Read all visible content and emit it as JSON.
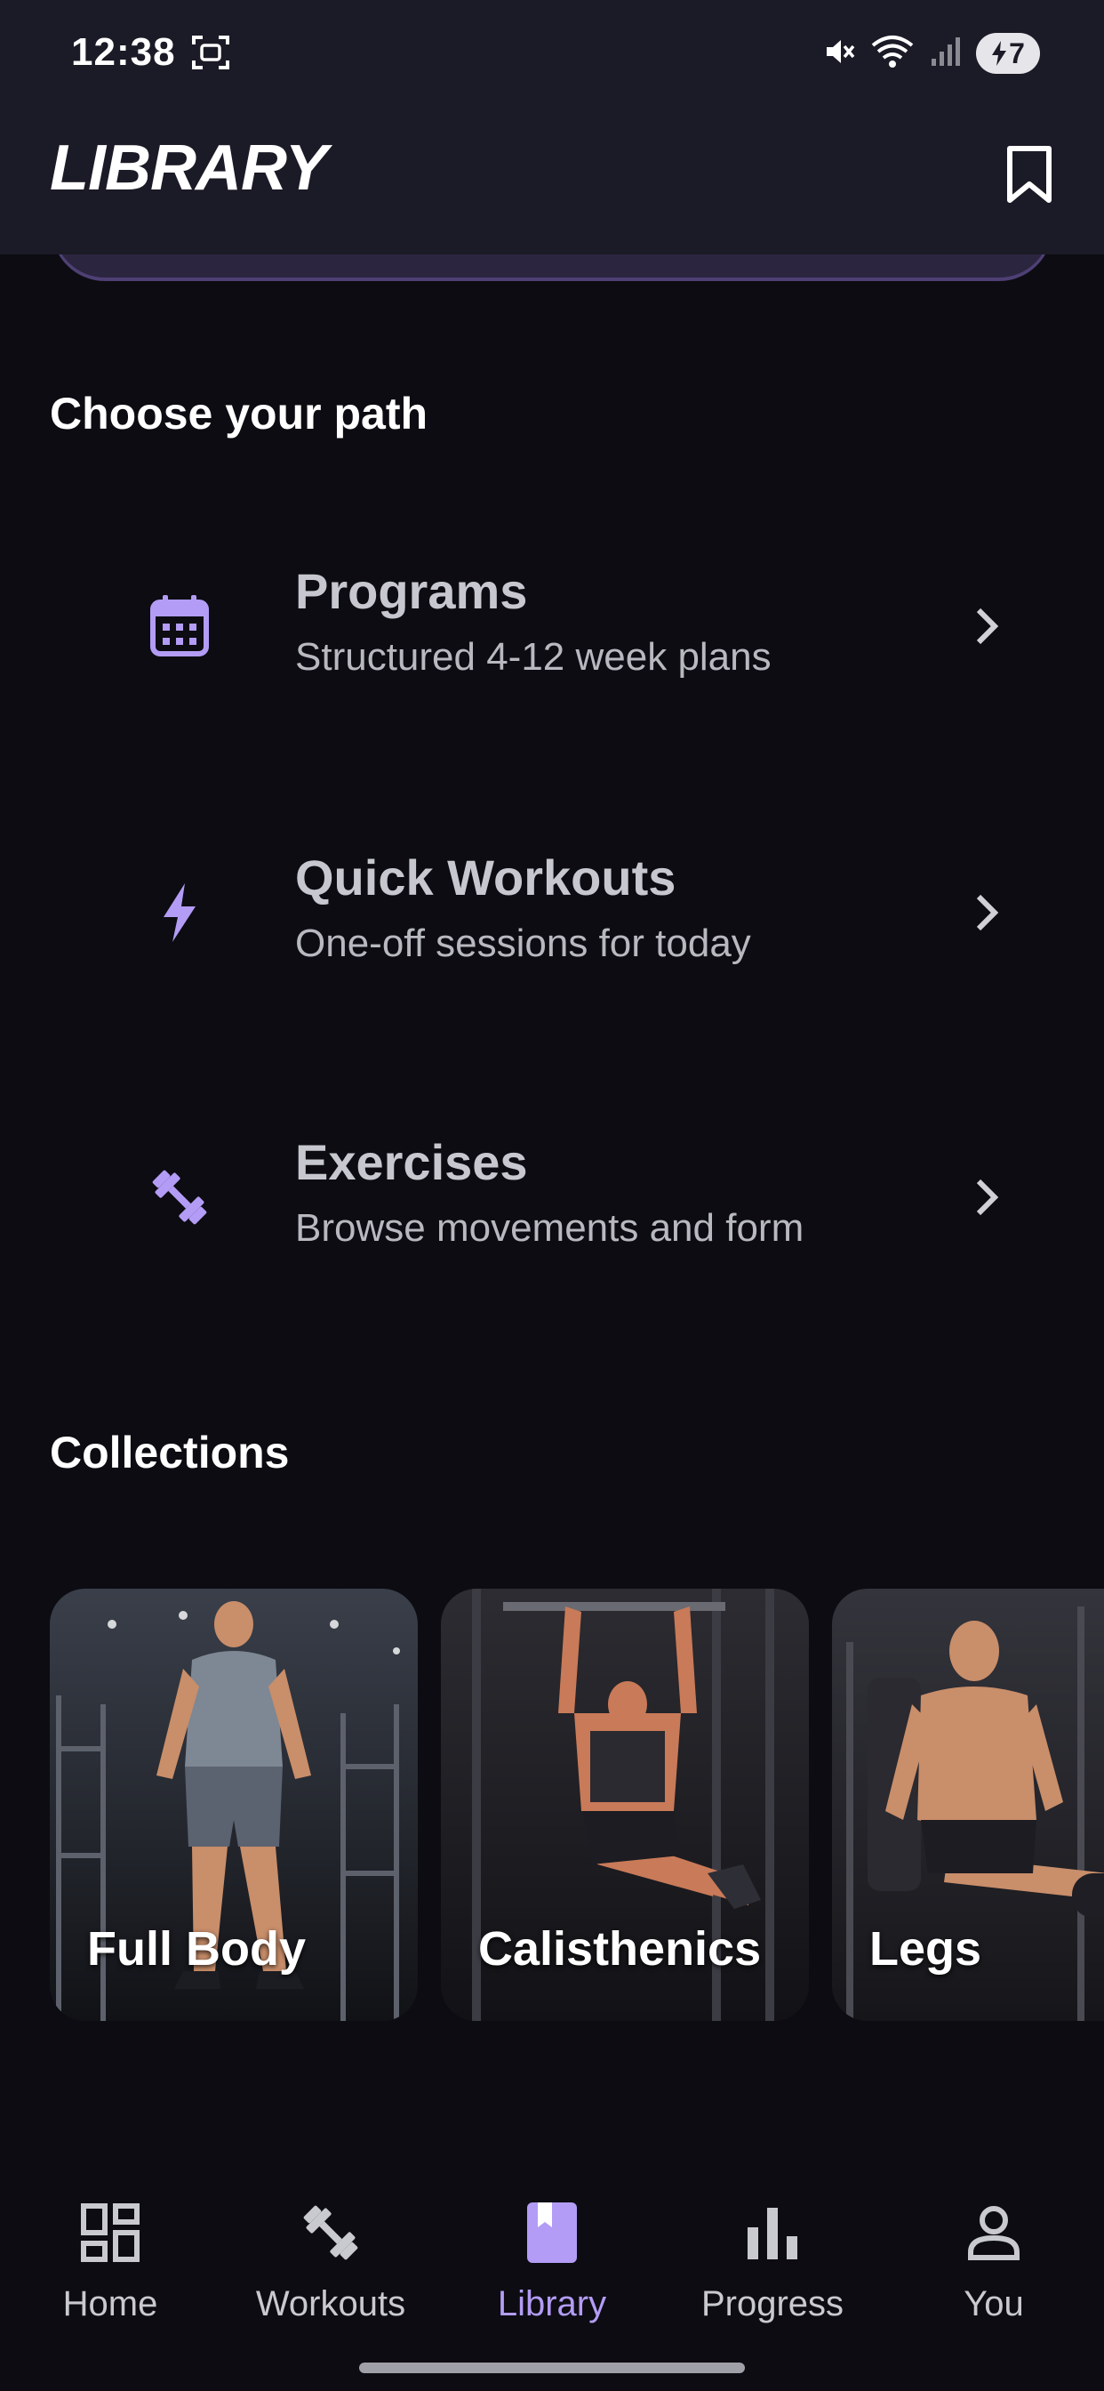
{
  "status_bar": {
    "time": "12:38",
    "battery_level": "7",
    "icons": [
      "screenshot-icon",
      "mute-icon",
      "wifi-icon",
      "signal-icon",
      "battery-icon"
    ]
  },
  "header": {
    "title": "LIBRARY",
    "bookmark_icon": "bookmark-icon"
  },
  "choose_path": {
    "heading": "Choose your path",
    "items": [
      {
        "title": "Programs",
        "subtitle": "Structured 4-12 week plans",
        "icon": "calendar-icon"
      },
      {
        "title": "Quick Workouts",
        "subtitle": "One-off sessions for today",
        "icon": "lightning-icon"
      },
      {
        "title": "Exercises",
        "subtitle": "Browse movements and form",
        "icon": "dumbbell-icon"
      }
    ]
  },
  "collections": {
    "heading": "Collections",
    "cards": [
      {
        "label": "Full Body"
      },
      {
        "label": "Calisthenics"
      },
      {
        "label": "Legs"
      }
    ]
  },
  "bottom_nav": {
    "items": [
      {
        "label": "Home",
        "icon": "dashboard-icon"
      },
      {
        "label": "Workouts",
        "icon": "dumbbell-icon"
      },
      {
        "label": "Library",
        "icon": "book-icon",
        "active": true
      },
      {
        "label": "Progress",
        "icon": "bar-chart-icon"
      },
      {
        "label": "You",
        "icon": "person-icon"
      }
    ]
  },
  "colors": {
    "accent": "#b39cf5",
    "background": "#0c0c12",
    "header_bg": "#1b1b27"
  }
}
